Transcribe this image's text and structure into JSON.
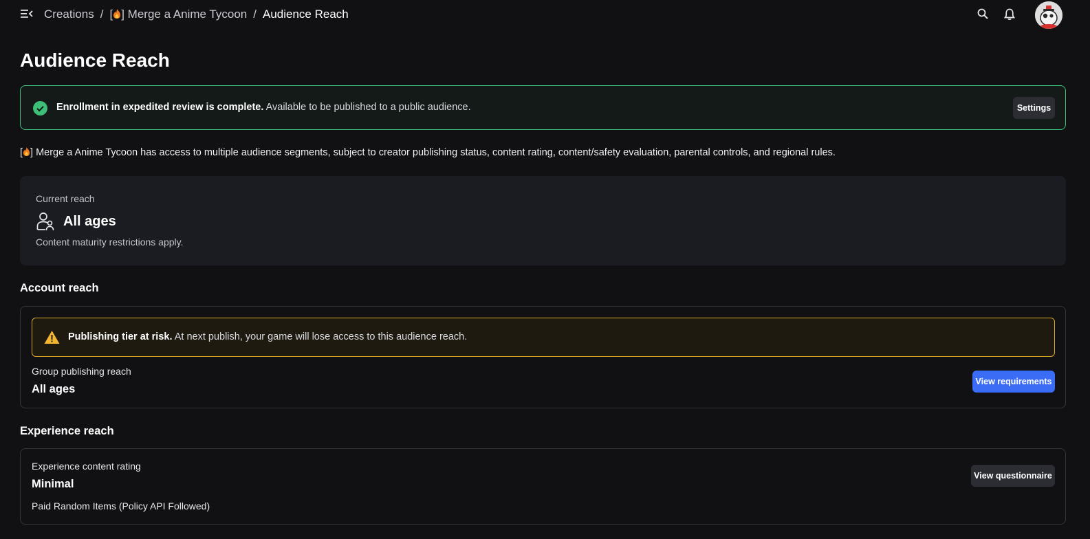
{
  "header": {
    "breadcrumb": {
      "root": "Creations",
      "sep1": "/",
      "game_prefix": "[",
      "game_suffix": "] Merge a Anime Tycoon",
      "sep2": "/",
      "current": "Audience Reach"
    },
    "icons": [
      "menu-collapse-icon",
      "search-icon",
      "bell-icon",
      "avatar"
    ]
  },
  "page": {
    "title": "Audience Reach"
  },
  "success_banner": {
    "bold": "Enrollment in expedited review is complete.",
    "text": " Available to be published to a public audience.",
    "button": "Settings"
  },
  "intro": {
    "prefix": "[",
    "text": "] Merge a Anime Tycoon has access to multiple audience segments, subject to creator publishing status, content rating, content/safety evaluation, parental controls, and regional rules."
  },
  "current_reach": {
    "label": "Current reach",
    "value": "All ages",
    "note": "Content maturity restrictions apply."
  },
  "account_reach": {
    "title": "Account reach",
    "warning_bold": "Publishing tier at risk.",
    "warning_text": " At next publish, your game will lose access to this audience reach.",
    "field_label": "Group publishing reach",
    "field_value": "All ages",
    "button": "View requirements"
  },
  "experience_reach": {
    "title": "Experience reach",
    "field_label": "Experience content rating",
    "field_value": "Minimal",
    "descriptor": "Paid Random Items (Policy API Followed)",
    "button": "View questionnaire"
  },
  "colors": {
    "background": "#111114",
    "success": "#3dbf78",
    "warning": "#d9a826",
    "primary": "#3b6cf6"
  }
}
